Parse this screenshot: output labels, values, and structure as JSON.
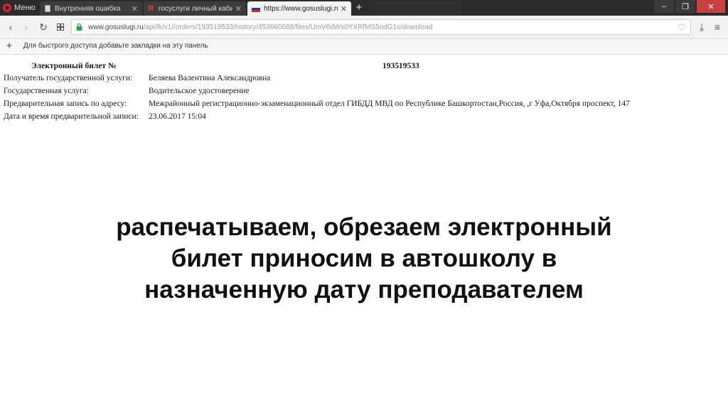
{
  "browser": {
    "menu_label": "Меню",
    "tabs": [
      {
        "label": "Внутренняя ошибка",
        "icon": "page-icon"
      },
      {
        "label": "госуслуги личный кабинет",
        "icon": "yandex-icon"
      },
      {
        "label": "https://www.gosuslugi.ru/api",
        "icon": "russia-flag-icon",
        "active": true
      }
    ],
    "new_tab_label": "+",
    "window_controls": {
      "minimize": "–",
      "restore": "❐",
      "close": "✕"
    }
  },
  "address_bar": {
    "url_domain": "www.gosuslugi.ru",
    "url_path": "/api/lk/v1//orders/193519533/history/453660688/files/UmV6dWx0YXRfMS5odG1s/download"
  },
  "bookmarks_bar": {
    "add_label": "+",
    "hint": "Для быстрого доступа добавьте закладки на эту панель"
  },
  "document": {
    "title": "Электронный билет №",
    "ticket_number": "193519533",
    "rows": [
      {
        "label": "Получатель государственной услуги:",
        "value": "Беляева Валентина Александровна"
      },
      {
        "label": "Государственная услуга:",
        "value": "Водительское удостоверение"
      },
      {
        "label": "Предварительная запись по адресу:",
        "value": "Межрайонный регистрационно-экзаменационный отдел ГИБДД МВД по Республике Башкортостан,Россия, ,г Уфа,Октября проспект, 147"
      },
      {
        "label": "Дата и время предварительной записи:",
        "value": "23.06.2017 15:04"
      }
    ]
  },
  "caption": {
    "lines": [
      "распечатываем, обрезаем электронный",
      "билет приносим в автошколу в",
      "назначенную дату преподавателем"
    ]
  },
  "colors": {
    "tabbar_bg": "#2b2b2b",
    "opera_red": "#e2232a",
    "lock_green": "#2ea44f"
  }
}
